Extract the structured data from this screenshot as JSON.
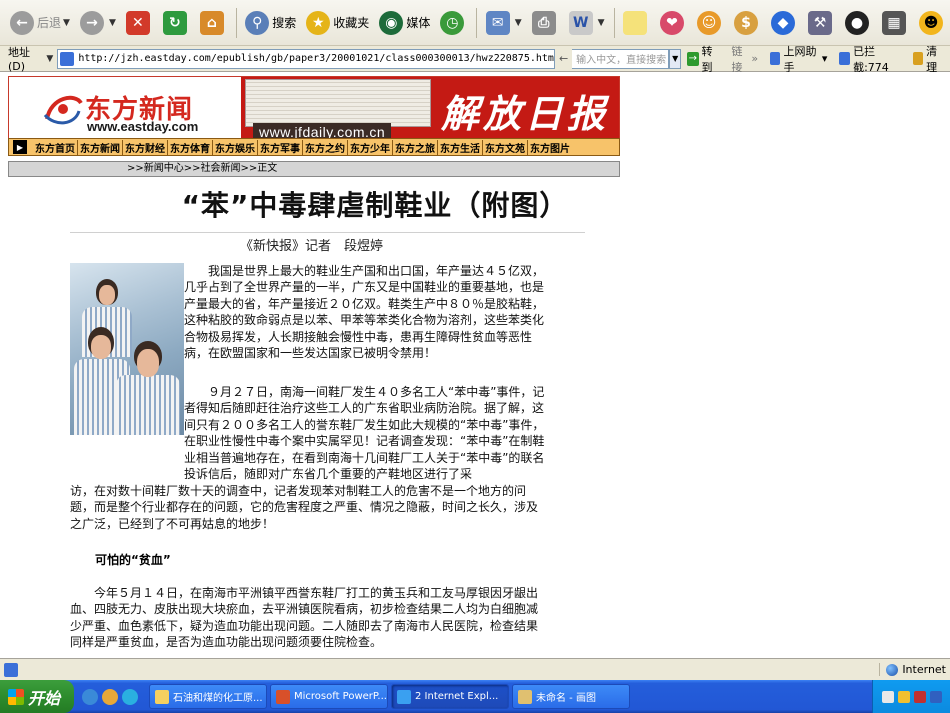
{
  "toolbar": {
    "back": "后退",
    "search": "搜索",
    "favorites": "收藏夹",
    "media": "媒体"
  },
  "address": {
    "label": "地址(D)",
    "url": "http://jzh.eastday.com/epublish/gb/paper3/20001021/class000300013/hwz220875.htm",
    "search_placeholder": "输入中文，直接搜索",
    "go": "转到",
    "links": "链接",
    "helper": "上网助手",
    "blocked": "已拦截:774",
    "clean": "清理"
  },
  "banner": {
    "logo_cn": "东方新闻",
    "logo_en": "www.eastday.com",
    "jf_url": "www.jfdaily.com.cn",
    "jf_title": "解放日报"
  },
  "nav": [
    "东方首页",
    "东方新闻",
    "东方财经",
    "东方体育",
    "东方娱乐",
    "东方军事",
    "东方之约",
    "东方少年",
    "东方之旅",
    "东方生活",
    "东方文苑",
    "东方图片"
  ],
  "breadcrumb": ">>新闻中心>>社会新闻>>正文",
  "article": {
    "title": "“苯”中毒肆虐制鞋业（附图）",
    "byline": "《新快报》记者　段煜婷",
    "p1": "我国是世界上最大的鞋业生产国和出口国，年产量达４５亿双，几乎占到了全世界产量的一半，广东又是中国鞋业的重要基地，也是产量最大的省，年产量接近２０亿双。鞋类生产中８０％是胶粘鞋，这种粘胶的致命弱点是以苯、甲苯等苯类化合物为溶剂，这些苯类化合物极易挥发，人长期接触会慢性中毒，患再生障碍性贫血等恶性病，在欧盟国家和一些发达国家已被明令禁用！",
    "p2": "９月２７日，南海一间鞋厂发生４０多名工人“苯中毒”事件，记者得知后随即赶往治疗这些工人的广东省职业病防治院。据了解，这间只有２００多名工人的誉东鞋厂发生如此大规模的“苯中毒”事件，在职业性慢性中毒个案中实属罕见！记者调查发现：“苯中毒”在制鞋业相当普遍地存在，在看到南海十几间鞋厂工人关于“苯中毒”的联名投诉信后，随即对广东省几个重要的产鞋地区进行了采",
    "p3": "访，在对数十间鞋厂数十天的调查中，记者发现苯对制鞋工人的危害不是一个地方的问题，而是整个行业都存在的问题，它的危害程度之严重、情况之隐蔽，时间之长久，涉及之广泛，已经到了不可再姑息的地步！",
    "subhead": "可怕的“贫血”",
    "p4": "今年５月１４日，在南海市平洲镇平西誉东鞋厂打工的黄玉兵和工友马厚银因牙龈出血、四肢无力、皮肤出现大块瘀血，去平洲镇医院看病，初步检查结果二人均为白细胞减少严重、血色素低下，疑为造血功能出现问题。二人随即去了南海市人民医院，检查结果同样是严重贫血，是否为造血功能出现问题须要住院检查。"
  },
  "status": {
    "zone": "Internet"
  },
  "taskbar": {
    "start": "开始",
    "tasks": [
      "石油和煤的化工原...",
      "Microsoft PowerP...",
      "2 Internet Expl...",
      "未命名 - 画图"
    ]
  },
  "colors": {
    "brand_red": "#c41a14",
    "nav_orange": "#f7c36a",
    "xp_blue": "#245edb",
    "start_green": "#2d8c2d"
  }
}
